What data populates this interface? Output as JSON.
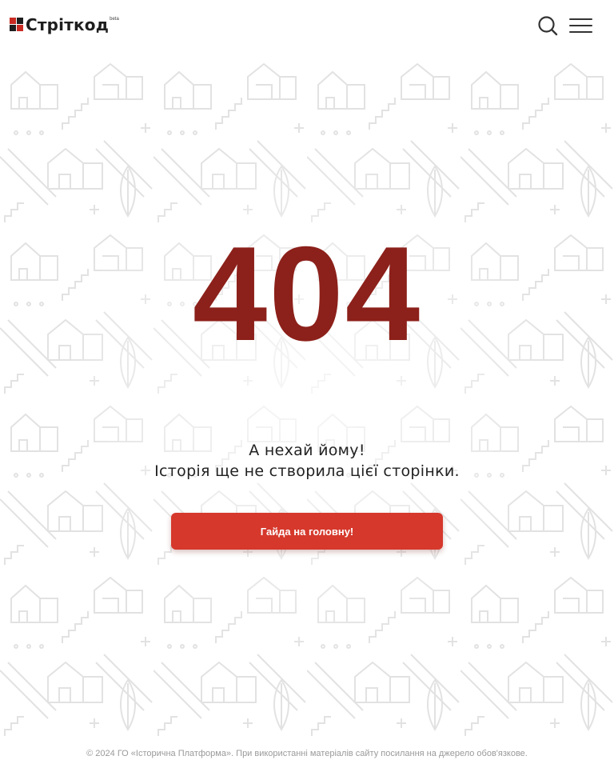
{
  "header": {
    "logo_text": "Стріткод",
    "logo_badge": "beta",
    "search_icon": "search-icon",
    "menu_icon": "hamburger-menu-icon"
  },
  "main": {
    "error_code": "404",
    "message_line1": "А нехай йому!",
    "message_line2": "Історія ще не створила цієї сторінки.",
    "home_button_label": "Гайда на головну!"
  },
  "footer": {
    "copyright": "© 2024 ГО «Історична Платформа». При використанні матеріалів сайту посилання на джерело обов'язкове."
  },
  "colors": {
    "accent": "#d6382c",
    "error_code": "#8c201a",
    "pattern_line": "#e4e4e4",
    "footer_text": "#9a9a9a"
  }
}
